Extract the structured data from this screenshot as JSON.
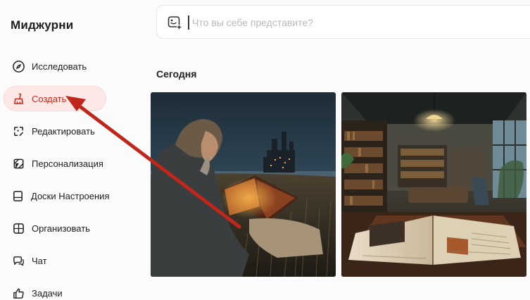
{
  "app": {
    "title": "Миджурни"
  },
  "sidebar": {
    "items": [
      {
        "label": "Исследовать",
        "icon": "compass-icon"
      },
      {
        "label": "Создать",
        "icon": "brush-icon",
        "active": true
      },
      {
        "label": "Редактировать",
        "icon": "edit-frame-icon"
      },
      {
        "label": "Персонализация",
        "icon": "personalize-icon"
      },
      {
        "label": "Доски Настроения",
        "icon": "moodboard-icon"
      },
      {
        "label": "Организовать",
        "icon": "grid-icon"
      },
      {
        "label": "Чат",
        "icon": "chat-icon"
      },
      {
        "label": "Задачи",
        "icon": "thumbs-up-icon"
      }
    ]
  },
  "prompt": {
    "placeholder": "Что вы себе представите?",
    "icon": "image-add-icon"
  },
  "feed": {
    "section_title": "Сегодня",
    "images": [
      {
        "subject": "man-reading-book-castle-night"
      },
      {
        "subject": "library-room-open-book"
      }
    ]
  },
  "annotation": {
    "arrow_color": "#c0261a",
    "target": "Создать"
  },
  "colors": {
    "accent": "#c8281c",
    "active_bg": "#fde8e6"
  }
}
